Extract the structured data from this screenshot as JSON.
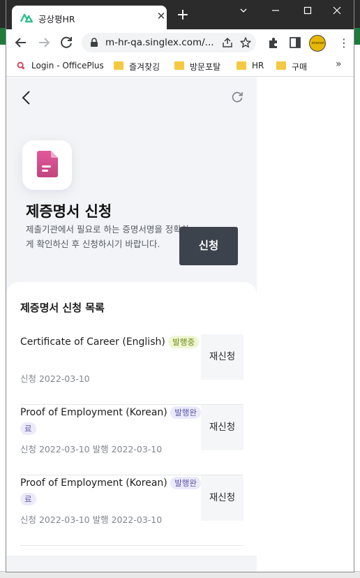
{
  "browser": {
    "tab_title": "공상평HR",
    "tab_close_glyph": "✕",
    "new_tab_glyph": "+",
    "url": "m-hr-qa.singlex.com/...",
    "bookmarks": [
      {
        "label": "Login - OfficePlus",
        "icon": "officeplus-icon"
      },
      {
        "label": "즐겨찾깅",
        "icon": "folder-icon"
      },
      {
        "label": "방문포탈",
        "icon": "folder-icon"
      },
      {
        "label": "HR",
        "icon": "folder-icon"
      },
      {
        "label": "구매",
        "icon": "folder-icon"
      }
    ],
    "bookmarks_more": "»",
    "profile_text": "ononon",
    "kebab_glyph": "⋮",
    "accent_color": "#2b2b2b"
  },
  "header": {
    "back_icon": "chevron-left-icon",
    "refresh_icon": "refresh-icon"
  },
  "hero": {
    "icon": "document-icon",
    "icon_color": "#d04f8f",
    "title": "제증명서 신청",
    "description": "제출기관에서 필요로 하는 증명서명을 정확하게 확인하신 후 신청하시기 바랍니다.",
    "apply_button": "신청"
  },
  "list": {
    "title": "제증명서 신청 목록",
    "items": [
      {
        "name": "Certificate of Career (English)",
        "status": "발행중",
        "status_color": "green",
        "date_text": "신청 2022-03-10",
        "button": "재신청"
      },
      {
        "name": "Proof of Employment (Korean)",
        "status": "발행완료",
        "status_color": "purple",
        "date_text": "신청 2022-03-10 발행 2022-03-10",
        "button": "재신청"
      },
      {
        "name": "Proof of Employment (Korean)",
        "status": "발행완료",
        "status_color": "purple",
        "date_text": "신청 2022-03-10 발행 2022-03-10",
        "button": "재신청"
      }
    ]
  }
}
